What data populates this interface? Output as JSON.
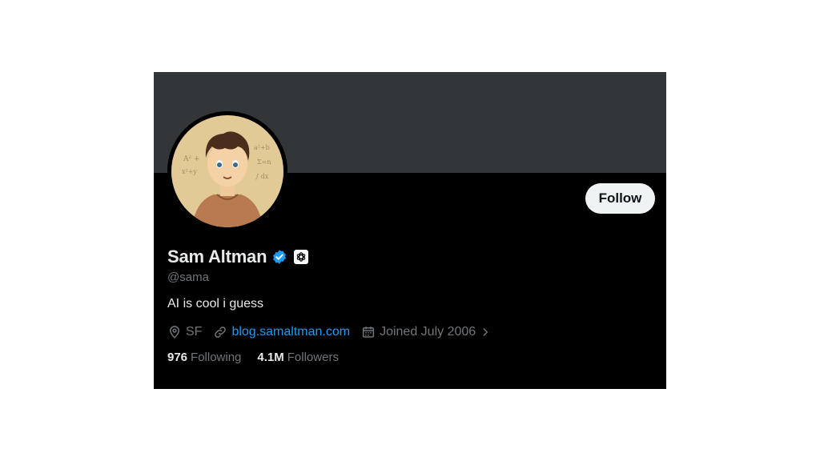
{
  "profile": {
    "name": "Sam Altman",
    "handle": "@sama",
    "bio": "AI is cool i guess",
    "location": "SF",
    "website": "blog.samaltman.com",
    "joined": "Joined July 2006",
    "following_count": "976",
    "following_label": "Following",
    "followers_count": "4.1M",
    "followers_label": "Followers"
  },
  "actions": {
    "follow_label": "Follow"
  },
  "icons": {
    "verified": "verified-badge-icon",
    "affiliation": "openai-logo-icon",
    "location": "location-pin-icon",
    "link": "link-icon",
    "calendar": "calendar-icon",
    "chevron": "chevron-right-icon"
  },
  "colors": {
    "background": "#000000",
    "banner": "#333639",
    "primary_text": "#e7e9ea",
    "secondary_text": "#71767b",
    "accent": "#1d9bf0",
    "follow_button_bg": "#eff3f4"
  }
}
